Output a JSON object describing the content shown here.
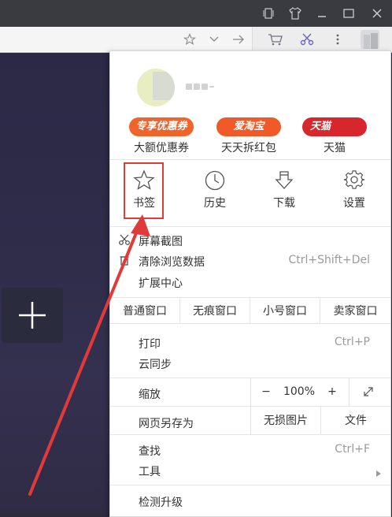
{
  "titlebar": {
    "icons": [
      "window-icon",
      "shirt-icon",
      "minimize-icon",
      "maximize-icon",
      "close-icon"
    ]
  },
  "toolbar": {
    "icons": [
      "star-icon",
      "chevron-down-icon",
      "arrow-right-icon",
      "cart-icon",
      "scissors-icon",
      "more-vertical-icon",
      "avatar"
    ]
  },
  "newtab": {
    "icon": "plus-icon"
  },
  "menu": {
    "profile": {},
    "promos": [
      {
        "pill": "专享优惠券",
        "label": "大额优惠券",
        "color": "#f0632b"
      },
      {
        "pill": "爱淘宝",
        "label": "天天拆红包",
        "color": "#f05a28"
      },
      {
        "pill": "天猫",
        "label": "天猫",
        "color": "#d8262d"
      }
    ],
    "quick": [
      {
        "label": "书签",
        "icon": "bookmark-star-icon"
      },
      {
        "label": "历史",
        "icon": "clock-icon"
      },
      {
        "label": "下载",
        "icon": "download-icon"
      },
      {
        "label": "设置",
        "icon": "gear-icon"
      }
    ],
    "tools": [
      {
        "label": "屏幕截图",
        "shortcut": "",
        "icon": "scissors-icon"
      },
      {
        "label": "清除浏览数据",
        "shortcut": "Ctrl+Shift+Del",
        "icon": "trash-icon"
      },
      {
        "label": "扩展中心",
        "shortcut": ""
      }
    ],
    "windows": [
      "普通窗口",
      "无痕窗口",
      "小号窗口",
      "卖家窗口"
    ],
    "sync": [
      {
        "label": "打印",
        "shortcut": "Ctrl+P"
      },
      {
        "label": "云同步",
        "shortcut": ""
      }
    ],
    "zoom": {
      "label": "缩放",
      "minus": "−",
      "value": "100%",
      "plus": "+",
      "fullscreen_icon": "expand-icon"
    },
    "save": {
      "label": "网页另存为",
      "lossless": "无损图片",
      "file": "文件"
    },
    "find": {
      "label": "查找",
      "shortcut": "Ctrl+F"
    },
    "tools_menu": {
      "label": "工具",
      "icon": "chevron-right-icon"
    },
    "upgrade": {
      "label": "检测升级"
    }
  },
  "annotation": {
    "color": "#e03a3a"
  }
}
